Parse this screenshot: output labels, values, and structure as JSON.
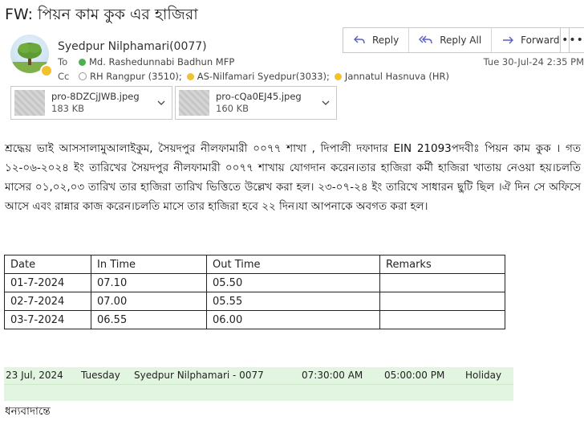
{
  "subject": "FW: পিয়ন কাম কুক এর হাজিরা",
  "sender": "Syedpur Nilphamari(0077)",
  "to": {
    "label": "To",
    "recipient": "Md. Rashedunnabi Badhun MFP"
  },
  "cc": {
    "label": "Cc",
    "recipients": [
      "RH Rangpur (3510);",
      "AS-Nilfamari Syedpur(3033);",
      "Jannatul Hasnuva (HR)"
    ]
  },
  "actions": {
    "reply": "Reply",
    "reply_all": "Reply All",
    "forward": "Forward",
    "more": "•••"
  },
  "timestamp": "Tue 30-Jul-24 2:35 PM",
  "attachments": [
    {
      "name": "pro-8DZCjJWB.jpeg",
      "size": "183 KB"
    },
    {
      "name": "pro-cQa0EJ45.jpeg",
      "size": "160 KB"
    }
  ],
  "body": {
    "paragraph": "শ্রদ্ধেয় ভাই আসসালামুআলাইকুম, সৈয়দপুর নীলফামারী ০০৭৭ শাখা , দিপালী দফাদার EIN 21093পদবীঃ পিয়ন কাম কুক । গত ১২-০৬-২০২৪ ইং তারিখের সৈয়দপুর নীলফামারী ০০৭৭ শাখায় যোগদান করেন।তার হাজিরা কর্মী হাজিরা খাতায় নেওয়া হয়।চলতি মাসের ০১,০২,০৩ তারিখ তার হাজিরা তারিখ ভিত্তিতে উল্লেখ করা হল। ২৩-০৭-২৪ ইং তারিখে সাধারন ছুটি ছিল ।ঐ দিন সে অফিসে আসে এবং রান্নার কাজ করেন।চলতি মাসে  তার হাজিরা হবে ২২ দিন।যা আপনাকে অবগত করা হল।",
    "signoff": "ধন্যবাদান্তে"
  },
  "attendance_table": {
    "headers": [
      "Date",
      "In  Time",
      "Out  Time",
      "Remarks"
    ],
    "rows": [
      [
        "01-7-2024",
        "07.10",
        "05.50",
        ""
      ],
      [
        "02-7-2024",
        "07.00",
        "05.55",
        ""
      ],
      [
        "03-7-2024",
        "06.55",
        "06.00",
        ""
      ]
    ]
  },
  "holiday_row": {
    "date": "23 Jul, 2024",
    "day": "Tuesday",
    "branch": "Syedpur Nilphamari - 0077",
    "in": "07:30:00 AM",
    "out": "05:00:00 PM",
    "status": "Holiday"
  },
  "colors": {
    "accent": "#5b5fc7",
    "presence": "#f2c12e",
    "holiday_bg": "#e2f5e0"
  }
}
